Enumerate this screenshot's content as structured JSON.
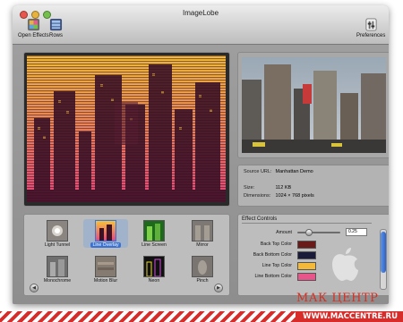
{
  "window": {
    "title": "ImageLobe"
  },
  "toolbar": {
    "open_effects": "Open Effects",
    "rows": "Rows",
    "preferences": "Preferences"
  },
  "info": {
    "source_url_label": "Source URL:",
    "source_url_value": "Manhattan Demo",
    "size_label": "Size:",
    "size_value": "112 KB",
    "dimensions_label": "Dimensions:",
    "dimensions_value": "1024 × 768 pixels"
  },
  "effects": {
    "row1": [
      "Light Tunnel",
      "Line Overlay",
      "Line Screen",
      "Mirror"
    ],
    "row2": [
      "Monochrome",
      "Motion Blur",
      "Neon",
      "Pinch"
    ],
    "selected": "Line Overlay"
  },
  "controls": {
    "title": "Effect Controls",
    "amount_label": "Amount",
    "amount_value": "0.25",
    "amount_fraction": 0.25,
    "colors": [
      {
        "label": "Back Top Color",
        "color": "#6b1a1a"
      },
      {
        "label": "Back Bottom Color",
        "color": "#1a1a3a"
      },
      {
        "label": "Line Top Color",
        "color": "#f5b93a"
      },
      {
        "label": "Line Bottom Color",
        "color": "#e8558a"
      }
    ]
  },
  "watermark": {
    "text": "МАК ЦЕНТР",
    "url": "WWW.MACCENTRE.RU"
  },
  "icons": [
    "open-effects-icon",
    "rows-icon",
    "preferences-icon",
    "left-arrow-icon",
    "right-arrow-icon",
    "apple-logo-icon"
  ],
  "colors": {
    "accent": "#3a72d3",
    "window_bg": "#a9a9a9",
    "brand_red": "#d62d2b"
  }
}
